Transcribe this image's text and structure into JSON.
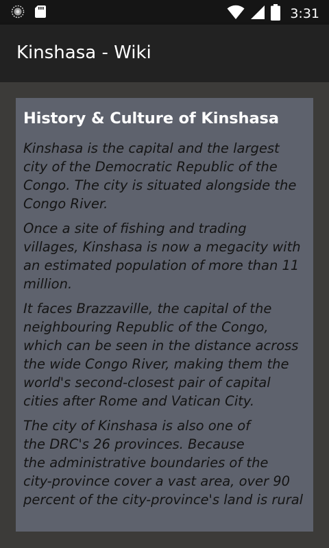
{
  "status_bar": {
    "time": "3:31",
    "icons": [
      "notification-icon",
      "sd-card-icon",
      "wifi-icon",
      "cell-signal-icon",
      "battery-icon"
    ]
  },
  "app_bar": {
    "title": "Kinshasa - Wiki"
  },
  "article": {
    "title": "History & Culture of Kinshasa",
    "paragraphs": [
      "Kinshasa is the capital and the largest\ncity of the Democratic Republic of the\nCongo. The city is situated alongside the\nCongo River.",
      "Once a site of fishing and trading\nvillages, Kinshasa is now a megacity with\nan estimated population of more than 11\nmillion.",
      "It faces Brazzaville, the capital of the\nneighbouring Republic of the Congo,\nwhich can be seen in the distance across\nthe wide Congo River, making them the\nworld's second-closest pair of capital\ncities after Rome and Vatican City.",
      "The city of Kinshasa is also one of\nthe DRC's 26 provinces. Because\nthe administrative boundaries of the\ncity-province cover a vast area, over 90\npercent of the city-province's land is rural"
    ]
  },
  "colors": {
    "status_bar": "#151515",
    "app_bar": "#222222",
    "background": "#3c3b39",
    "card": "#5e626d",
    "title_text": "#ffffff",
    "body_text": "#141414"
  }
}
